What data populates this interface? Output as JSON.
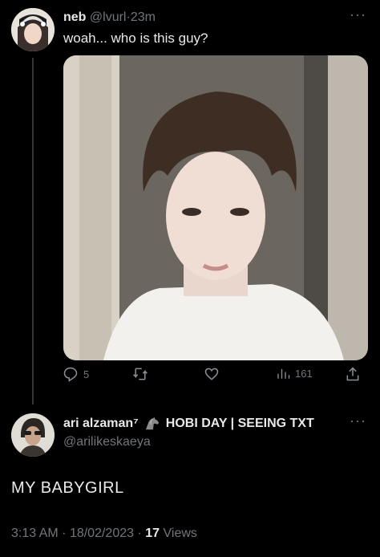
{
  "tweet1": {
    "name": "neb",
    "handle": "@lvurl",
    "separator": "·",
    "time": "23m",
    "more": "···",
    "text": "woah... who is this guy?",
    "actions": {
      "reply_count": "5",
      "views_count": "161"
    }
  },
  "tweet2": {
    "name": "ari alzaman⁷",
    "name_badge": "HOBI DAY | SEEING TXT",
    "handle": "@arilikeskaeya",
    "more": "···",
    "text": "MY BABYGIRL",
    "time": "3:13 AM",
    "date": "18/02/2023",
    "sep1": "·",
    "sep2": "·",
    "views_count": "17",
    "views_label": "Views"
  },
  "colors": {
    "background": "#000000",
    "text": "#e7e9ea",
    "muted": "#71767b",
    "thread_line": "#333639"
  }
}
